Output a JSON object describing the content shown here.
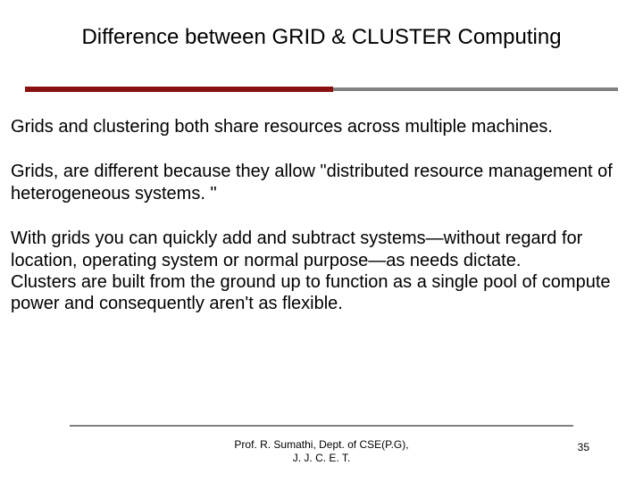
{
  "title": "Difference between GRID & CLUSTER Computing",
  "paragraphs": {
    "p1": "Grids and clustering both share resources across multiple machines.",
    "p2": "Grids,  are different because they allow \"distributed resource management of heterogeneous systems. \"",
    "p3": "With grids you can quickly add and subtract systems—without regard for location, operating system or normal purpose—as needs dictate.",
    "p4": "Clusters are built from the ground up to function as a single pool of compute power and consequently aren't as flexible."
  },
  "footer": {
    "center_line1": "Prof. R. Sumathi, Dept. of CSE(P.G),",
    "center_line2": "J. J. C. E. T.",
    "page_number": "35"
  }
}
